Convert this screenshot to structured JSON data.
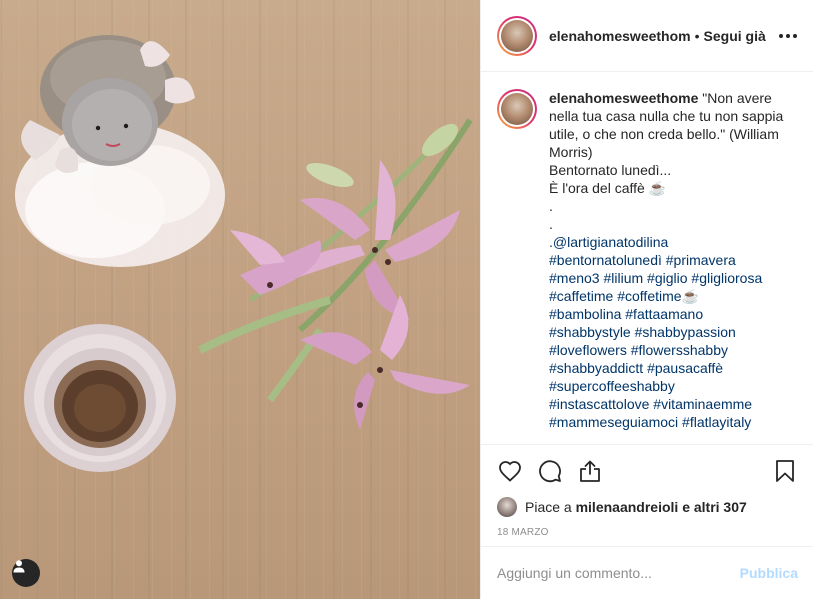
{
  "post": {
    "username": "elenahomesweethom",
    "separator": "•",
    "follow_label": "Segui già"
  },
  "caption": {
    "username": "elenahomesweethome",
    "lines": [
      "\"Non avere nella tua casa nulla che tu non sappia utile, o che non creda bello.\" (William Morris)",
      "Bentornato lunedì...",
      "È l'ora del caffè ☕",
      ".",
      "."
    ],
    "hashtag_lines": [
      ".@lartigianatodilina",
      "#bentornatolunedì #primavera",
      "#meno3 #lilium #giglio #gligliorosa",
      "#caffetime #coffetime☕",
      "#bambolina #fattaamano",
      "#shabbystyle #shabbypassion",
      "#loveflowers #flowersshabby",
      "#shabbyaddictt #pausacaffè",
      "#supercoffeeshabby",
      "#instascattolove #vitaminaemme",
      "#mammeseguiamoci #flatlayitaly"
    ]
  },
  "actions": {
    "like_icon": "heart-icon",
    "comment_icon": "comment-icon",
    "share_icon": "share-icon",
    "save_icon": "bookmark-icon"
  },
  "likes": {
    "prefix": "Piace a",
    "user": "milenaandreioli",
    "suffix": "e altri 307"
  },
  "date": "18 MARZO",
  "add_comment": {
    "placeholder": "Aggiungi un commento...",
    "post_label": "Pubblica"
  },
  "colors": {
    "link": "#003569",
    "post_disabled": "#b3dbff",
    "secondary_text": "#8e8e8e",
    "border": "#efefef"
  }
}
